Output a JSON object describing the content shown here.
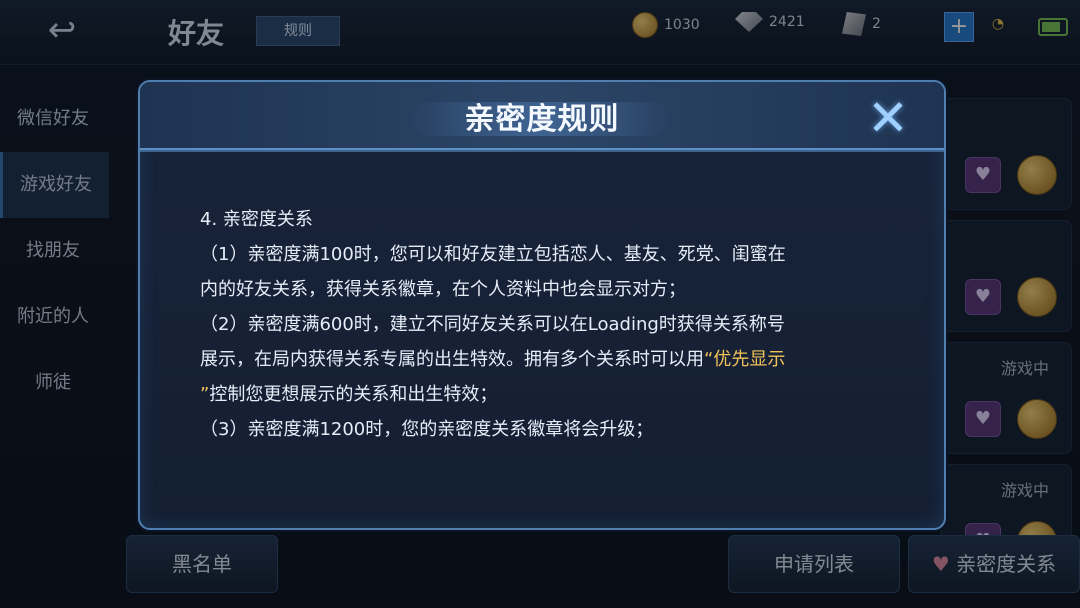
{
  "topbar": {
    "back_icon": "back-arrow-icon",
    "title": "好友",
    "rules_button": "规则",
    "currency": {
      "coins": "1030",
      "diamonds": "2421",
      "crystals": "2"
    },
    "icons": {
      "coin": "coin-icon",
      "diamond": "diamond-icon",
      "crystal": "crystal-icon",
      "plus": "plus-icon",
      "wifi": "wifi-icon",
      "battery": "battery-icon"
    }
  },
  "sidebar": {
    "items": [
      {
        "label": "微信好友"
      },
      {
        "label": "游戏好友",
        "active": true
      },
      {
        "label": "找朋友"
      },
      {
        "label": "附近的人"
      },
      {
        "label": "师徒"
      }
    ]
  },
  "right_panel": {
    "cards": [
      {
        "status": ""
      },
      {
        "status": ""
      },
      {
        "status": "游戏中"
      },
      {
        "status": "游戏中"
      }
    ],
    "icons": {
      "heart": "heart-icon",
      "medal": "medal-icon"
    }
  },
  "bottom": {
    "blacklist": "黑名单",
    "requests": "申请列表",
    "intimacy": "亲密度关系"
  },
  "modal": {
    "title": "亲密度规则",
    "close_icon": "close-icon",
    "section_title": "4. 亲密度关系",
    "p1_line1": "（1）亲密度满100时，您可以和好友建立包括恋人、基友、死党、闺蜜在",
    "p1_line2": "内的好友关系，获得关系徽章，在个人资料中也会显示对方；",
    "p2_line1": "（2）亲密度满600时，建立不同好友关系可以在Loading时获得关系称号",
    "p2_line2_pre": "展示，在局内获得关系专属的出生特效。拥有多个关系时可以用",
    "p2_highlight_open": "“优先显示",
    "p2_highlight_close": "”",
    "p2_line3_post": "控制您更想展示的关系和出生特效；",
    "p3_line1": "（3）亲密度满1200时，您的亲密度关系徽章将会升级；"
  },
  "colors": {
    "accent": "#4f7fb1",
    "highlight": "#f0c35a",
    "text": "#e6edf8"
  }
}
